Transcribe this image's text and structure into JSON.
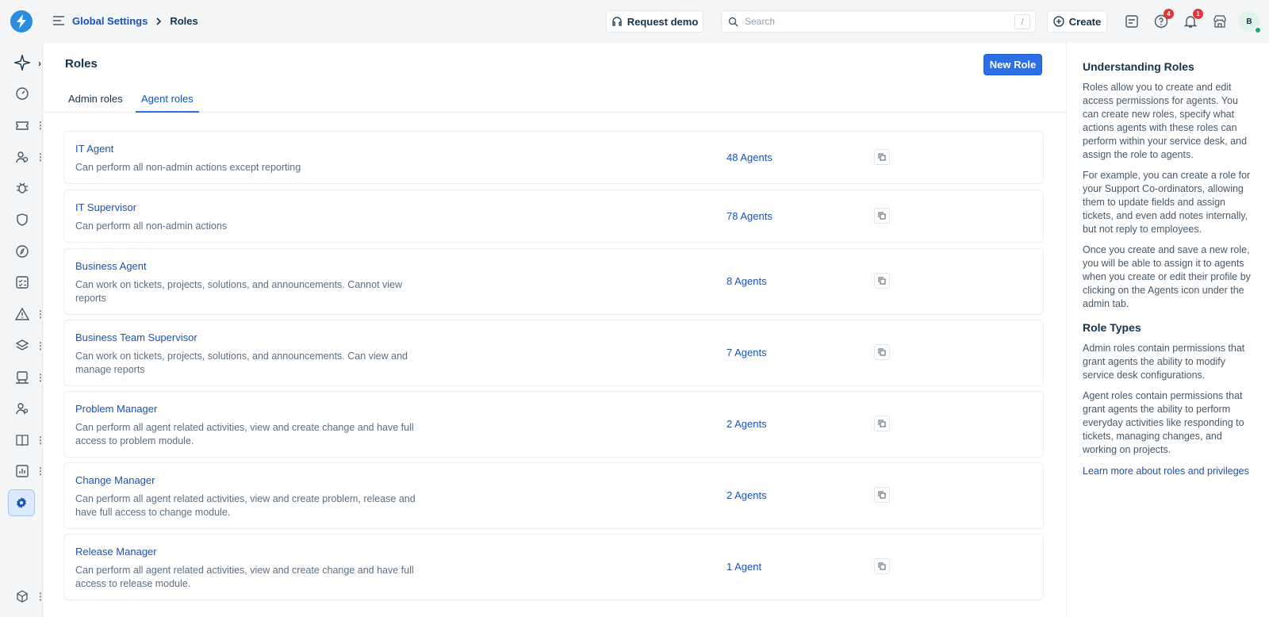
{
  "header": {
    "breadcrumb": {
      "parent": "Global Settings",
      "current": "Roles"
    },
    "request_demo_label": "Request demo",
    "search_placeholder": "Search",
    "search_shortcut": "/",
    "create_label": "Create",
    "help_badge": "4",
    "notifications_badge": "1",
    "avatar_initial": "B"
  },
  "sidebar": {
    "icons": [
      "sparkle-icon",
      "dashboard-icon",
      "ticket-icon",
      "people-icon",
      "bug-icon",
      "shield-icon",
      "compass-icon",
      "checklist-icon",
      "warning-icon",
      "layers-icon",
      "archive-icon",
      "agents-icon",
      "book-icon",
      "reports-icon",
      "settings-icon",
      "box-icon"
    ]
  },
  "main": {
    "title": "Roles",
    "new_role_label": "New Role",
    "tabs": [
      {
        "label": "Admin roles",
        "active": false
      },
      {
        "label": "Agent roles",
        "active": true
      }
    ],
    "roles": [
      {
        "name": "IT Agent",
        "desc": "Can perform all non-admin actions except reporting",
        "count": "48 Agents"
      },
      {
        "name": "IT Supervisor",
        "desc": "Can perform all non-admin actions",
        "count": "78 Agents"
      },
      {
        "name": "Business Agent",
        "desc": "Can work on tickets, projects, solutions, and announcements. Cannot view reports",
        "count": "8 Agents"
      },
      {
        "name": "Business Team Supervisor",
        "desc": "Can work on tickets, projects, solutions, and announcements. Can view and manage reports",
        "count": "7 Agents"
      },
      {
        "name": "Problem Manager",
        "desc": "Can perform all agent related activities, view and create change and have full access to problem module.",
        "count": "2 Agents"
      },
      {
        "name": "Change Manager",
        "desc": "Can perform all agent related activities, view and create problem, release and have full access to change module.",
        "count": "2 Agents"
      },
      {
        "name": "Release Manager",
        "desc": "Can perform all agent related activities, view and create change and have full access to release module.",
        "count": "1 Agent"
      }
    ]
  },
  "help_panel": {
    "heading1": "Understanding Roles",
    "p1": "Roles allow you to create and edit access permissions for agents. You can create new roles, specify what actions agents with these roles can perform within your service desk, and assign the role to agents.",
    "p2": "For example, you can create a role for your Support Co-ordinators, allowing them to update fields and assign tickets, and even add notes internally, but not reply to employees.",
    "p3": "Once you create and save a new role, you will be able to assign it to agents when you create or edit their profile by clicking on the Agents icon under the admin tab.",
    "heading2": "Role Types",
    "p4": "Admin roles contain permissions that grant agents the ability to modify service desk configurations.",
    "p5": "Agent roles contain permissions that grant agents the ability to perform everyday activities like responding to tickets, managing changes, and working on projects.",
    "link": "Learn more about roles and privileges"
  },
  "colors": {
    "accent": "#2c6fe5",
    "link": "#1a52b5",
    "badge": "#e43538",
    "online": "#1ea672"
  }
}
